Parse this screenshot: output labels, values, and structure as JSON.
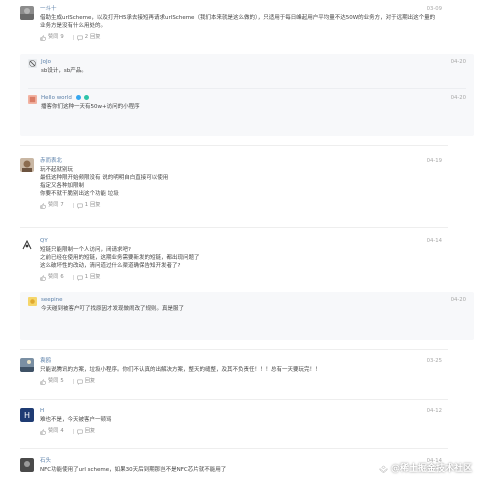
{
  "actions": {
    "like_label": "赞同",
    "reply_label": "回复"
  },
  "comments": [
    {
      "name": "一斗十",
      "time": "03-09",
      "lines": [
        "借助生成urlScheme，以及打开H5承去接短再请求urlScheme（我们本来就是这么做的），只适用于每日峰起用户平均量不达50W的业务方，对于远期出这个量的",
        "业务方是没有什么用处的。"
      ],
      "likes": "9",
      "replies_count": "2",
      "replies": [
        {
          "name": "JoJo",
          "time": "04-20",
          "text": "sb设计，sb产品。"
        },
        {
          "name": "Hello world",
          "time": "04-20",
          "text": "播客你们这种一天有50w+访问的小程序"
        }
      ]
    },
    {
      "name": "赤而表北",
      "time": "04-19",
      "lines": [
        "玩不起就别玩",
        "最低这种限开始频限没有 说的明明自白直接可以使用",
        "指定又各种加限制",
        "你要不就干脆别出这个功能 垃圾"
      ],
      "likes": "7",
      "replies_count": "1",
      "replies": []
    },
    {
      "name": "QY",
      "time": "04-14",
      "lines": [
        "短链只能限制一个人访问，闭请求吧?",
        "之前已经在使用的短链，这期业务需要新发的短链，都出现问题了",
        "这么破坏性的改动，清问道过什么渠道确保告知开发者了?"
      ],
      "likes": "6",
      "replies_count": "1",
      "replies": [
        {
          "name": "seepine",
          "time": "04-20",
          "text": "今天碰到被客户叮了找原因才发现做闹改了规则。真是服了"
        }
      ]
    },
    {
      "name": "袁鸥",
      "time": "03-25",
      "lines": [
        "只能说腾讯的方案，垃圾小程序。你们不认真的出解决方案，整天的缝整，及其不负责任！！！总有一天要玩完！！"
      ],
      "likes": "5",
      "replies_count": "",
      "replies": []
    },
    {
      "name": "H",
      "time": "04-12",
      "lines": [
        "难也不是，今天被客户一顿骂"
      ],
      "likes": "4",
      "replies_count": "",
      "replies": []
    },
    {
      "name": "石头",
      "time": "04-14",
      "lines": [
        "NFC功能使用了url scheme，如果30天后到期那岂不是NFC芯片就不能用了"
      ],
      "likes": "",
      "replies_count": "",
      "replies": []
    }
  ],
  "watermark": "@稀土掘金技术社区",
  "colors": {
    "name": "#5a7fa8",
    "time": "#a8a8a8",
    "reply_bg": "#f7f8fa",
    "text": "#444444"
  }
}
